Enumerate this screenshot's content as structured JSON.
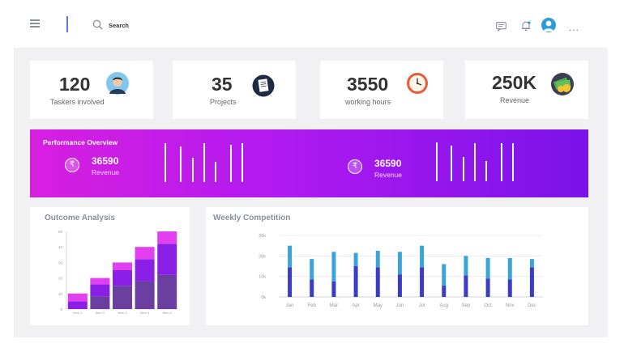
{
  "topbar": {
    "search_label": "Search",
    "icons": [
      "menu-icon",
      "search-icon",
      "chat-icon",
      "bell-icon",
      "user-avatar",
      "more-icon"
    ],
    "more": "..."
  },
  "stats": [
    {
      "value": "120",
      "label": "Taskers  involved",
      "icon": "person-icon"
    },
    {
      "value": "35",
      "label": "Projects",
      "icon": "document-icon"
    },
    {
      "value": "3550",
      "label": "working hours",
      "icon": "clock-icon"
    },
    {
      "value": "250K",
      "label": "Revenue",
      "icon": "money-icon"
    }
  ],
  "performance": {
    "title": "Performance Overview",
    "items": [
      {
        "value": "36590",
        "label": "Revenue",
        "icon": "rupee-icon"
      },
      {
        "value": "36590",
        "label": "Revenue",
        "icon": "rupee-icon"
      }
    ],
    "colors": {
      "start": "#d81fe0",
      "end": "#7a12ea"
    }
  },
  "outcome": {
    "title": "Outcome Analysis"
  },
  "weekly": {
    "title": "Weekly Competition"
  },
  "chart_data": [
    {
      "type": "bar",
      "stacked": true,
      "title": "Outcome Analysis",
      "categories": [
        "Item 1",
        "Item 2",
        "Item 3",
        "Item 4",
        "Item 5"
      ],
      "yticks": [
        "0",
        "10",
        "20",
        "30",
        "40",
        "50"
      ],
      "ylim": [
        0,
        50
      ],
      "series": [
        {
          "values": [
            0,
            8,
            15,
            18,
            22
          ],
          "color": "#6a3fa0"
        },
        {
          "values": [
            5,
            8,
            10,
            14,
            20
          ],
          "color": "#8a1fe6"
        },
        {
          "values": [
            5,
            4,
            5,
            8,
            8
          ],
          "color": "#e23ff0"
        }
      ]
    },
    {
      "type": "bar",
      "stacked": true,
      "title": "Weekly Competition",
      "categories": [
        "Jan",
        "Feb",
        "Mar",
        "Apr",
        "May",
        "Jun",
        "Jul",
        "Aug",
        "Sep",
        "Oct",
        "Nov",
        "Dec"
      ],
      "yticks": [
        "0k",
        "10k",
        "20k",
        "30k"
      ],
      "ylim": [
        0,
        30
      ],
      "grid": true,
      "series": [
        {
          "values": [
            14.5,
            8.5,
            7.5,
            15,
            14.5,
            11,
            14.5,
            5.5,
            10.5,
            9,
            8.5,
            14.5
          ],
          "color": "#3b3bc8"
        },
        {
          "values": [
            10.5,
            10,
            14.5,
            6.5,
            8,
            11,
            10.5,
            10.5,
            9.5,
            10,
            10.5,
            4
          ],
          "color": "#3aa4d8"
        }
      ]
    }
  ]
}
